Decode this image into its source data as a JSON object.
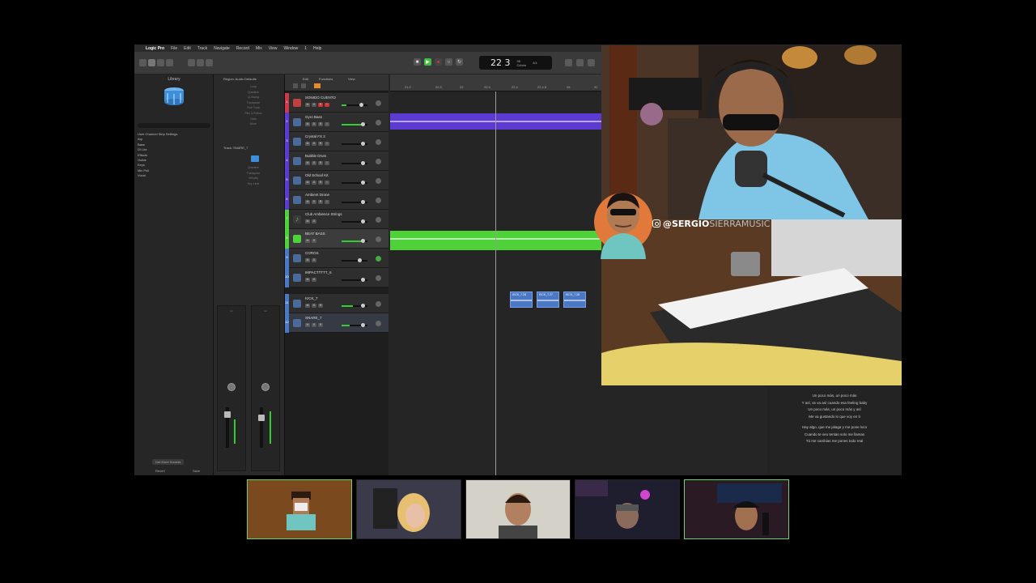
{
  "menubar": {
    "apple": "",
    "app_name": "Logic Pro",
    "items": [
      "File",
      "Edit",
      "Track",
      "Navigate",
      "Record",
      "Mix",
      "View",
      "Window",
      "1",
      "Help"
    ]
  },
  "lcd": {
    "position": "22 3",
    "tempo_label": "96",
    "tempo_sub": "4/4",
    "key": "C#min"
  },
  "library": {
    "title": "Library",
    "items": [
      "User Channel Strip Settings",
      "Arp",
      "Bass",
      "DI Lite",
      "Effects",
      "Guitar",
      "Keys",
      "Mic Pull",
      "Vocal"
    ],
    "more_sounds": "Get More Sounds",
    "revert": "Revert",
    "save": "Save"
  },
  "inspector": {
    "region_header": "Region: Audio Defaults",
    "track_header": "Track: SNARE_7",
    "region_rows": [
      "Loop",
      "Quantize",
      "Q-Swing",
      "Transpose",
      "Fine Tune",
      "Flex & Follow",
      "Gain",
      "More"
    ],
    "track_rows": [
      "Quantize",
      "Transpose",
      "Velocity",
      "Key Limit"
    ]
  },
  "tracks_header": {
    "edit": "Edit",
    "functions": "Functions",
    "view": "View"
  },
  "tracks": [
    {
      "num": "1",
      "name": "SONIDO CUENTO",
      "color": "#d0384a"
    },
    {
      "num": "2",
      "name": "Gyro Bass",
      "color": "#5b3bd1"
    },
    {
      "num": "3",
      "name": "Crystal FX 2",
      "color": "#5b3bd1"
    },
    {
      "num": "4",
      "name": "Bubble Drum",
      "color": "#5b3bd1"
    },
    {
      "num": "5",
      "name": "Old School Kit",
      "color": "#5b3bd1"
    },
    {
      "num": "6",
      "name": "Ambient Drone",
      "color": "#5b3bd1"
    },
    {
      "num": "7",
      "name": "Club Ambience Strings",
      "color": "#4fd13a"
    },
    {
      "num": "8",
      "name": "BEAT BASS",
      "color": "#4fd13a"
    },
    {
      "num": "9",
      "name": "COROS",
      "color": "#4a78c4"
    },
    {
      "num": "10",
      "name": "IMPACTTTTT_6",
      "color": "#4a78c4"
    },
    {
      "num": "11",
      "name": "KICK_7",
      "color": "#4a78c4"
    },
    {
      "num": "12",
      "name": "SNARE_7",
      "color": "#4a78c4"
    }
  ],
  "ruler": {
    "bars": [
      "21.2",
      "22.3",
      "22",
      "22.3",
      "22.4",
      "22.4 8",
      "26",
      "31"
    ]
  },
  "regions": {
    "kick_labels": [
      "KICK_7.28",
      "KICK_7.27",
      "KICK_7.28"
    ]
  },
  "lyrics": {
    "verse1": [
      "Un poco más, un poco más",
      "Y así, se va así cuando esa feeling baby",
      "Un poco más, un poco más y así",
      "Me va gustando lo que voy en ti"
    ],
    "verse2": [
      "Hay algo, que me jalaga y me pone loco",
      "Cuando te veo tentan solo me llamas",
      "Tú me cambias me pones todo real"
    ]
  },
  "webcam": {
    "handle_bold": "@SERGIO",
    "handle_rest": "SIERRAMUSIC"
  },
  "colors": {
    "green_region": "#4fd13a",
    "purple_region": "#5b3bd1",
    "blue_region": "#4a78c4",
    "active_border": "#6fd06f"
  }
}
